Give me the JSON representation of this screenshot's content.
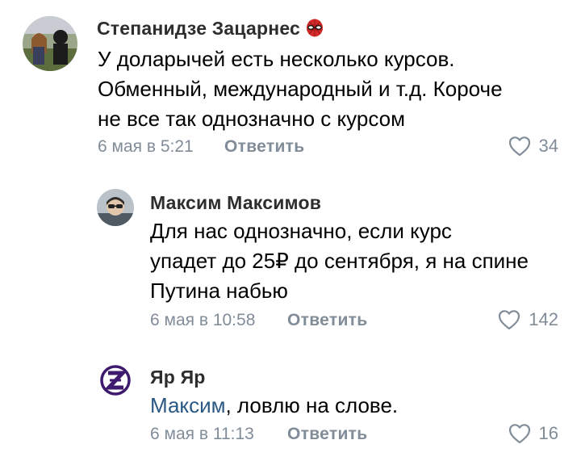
{
  "comments": [
    {
      "author": "Степанидзе Зацарнес",
      "author_emoji": "spider-mask-emoji",
      "lines": [
        "У доларычей есть несколько курсов.",
        "Обменный, международный и т.д. Короче",
        "не все так однозначно с курсом"
      ],
      "date": "6 мая в 5:21",
      "reply_label": "Ответить",
      "likes": "34"
    },
    {
      "author": "Максим Максимов",
      "lines": [
        "Для нас однозначно, если курс",
        "упадет до 25₽ до сентября, я на спине",
        "Путина набью"
      ],
      "date": "6 мая в 10:58",
      "reply_label": "Ответить",
      "likes": "142"
    },
    {
      "author": "Яр Яр",
      "mention": "Максим",
      "text_rest": ", ловлю на слове.",
      "date": "6 мая в 11:13",
      "reply_label": "Ответить",
      "likes": "16"
    }
  ],
  "colors": {
    "meta": "#818c99",
    "mention": "#2a5885",
    "author": "#2c2d2e"
  }
}
